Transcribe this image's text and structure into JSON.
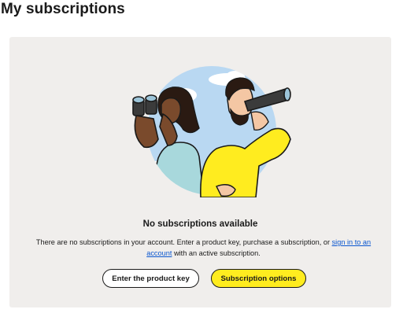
{
  "page": {
    "title": "My subscriptions"
  },
  "empty_state": {
    "illustration": "two-people-with-binoculars",
    "title": "No subscriptions available",
    "description_prefix": "There are no subscriptions in your account. Enter a product key, purchase a subscription, or ",
    "sign_in_link": "sign in to an account",
    "description_suffix": " with an active subscription."
  },
  "actions": {
    "enter_key_label": "Enter the product key",
    "options_label": "Subscription options"
  },
  "colors": {
    "card_bg": "#f0eeec",
    "primary_button": "#ffec1f",
    "link": "#0b57d0"
  }
}
